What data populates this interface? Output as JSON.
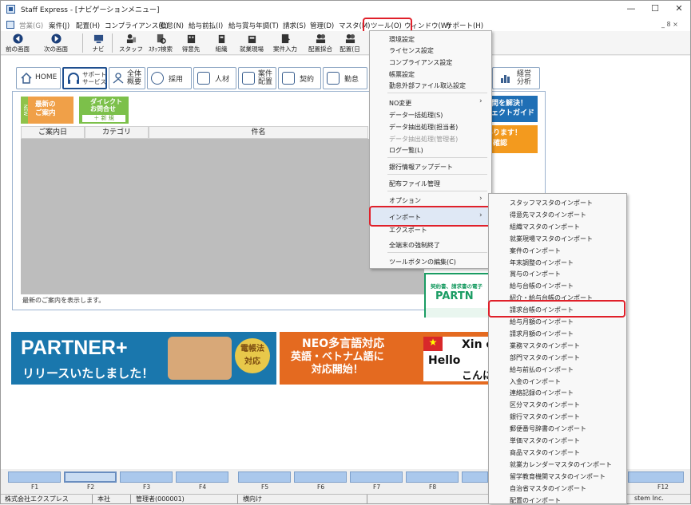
{
  "window": {
    "title": "Staff Express - [ナビゲーションメニュー]",
    "minimize": "—",
    "maximize": "☐",
    "close": "✕"
  },
  "menubar": {
    "items": [
      "営業(G)",
      "案件(J)",
      "配置(H)",
      "コンプライアンス(C)",
      "勤怠(N)",
      "給与前払(I)",
      "給与賞与年調(T)",
      "請求(S)",
      "管理(D)",
      "マスタ(M)",
      "ツール(O)",
      "ウィンドウ(W)",
      "サポート(H)"
    ],
    "mdi": "_ 8 ×"
  },
  "toolbar": {
    "items": [
      "前の画面",
      "次の画面",
      "ナビ",
      "スタッフ",
      "ｽﾀｯﾌ検索",
      "得意先",
      "組織",
      "就業現場",
      "案件入力",
      "配置採合",
      "配置(日"
    ]
  },
  "tabs": [
    "HOME",
    "サポート\nサービス",
    "全体\n概要",
    "採用",
    "人材",
    "案件\n配置",
    "契約",
    "勤怠",
    "経営\n分析"
  ],
  "notice": {
    "new_badge": "NEW",
    "btn_latest": "最新の\nご案内",
    "btn_direct": "ダイレクト\nお問合せ",
    "btn_new": "＋ 新 規",
    "columns": [
      "ご案内日",
      "カテゴリ",
      "件名"
    ],
    "footer": "最新のご案内を表示します。"
  },
  "side_banners": {
    "blue": "問を解決！\nェクトガイド",
    "orange": "ンがあります！\nートを確認",
    "teal_top": "契約書、請求書の電子",
    "teal_main": "PARTN",
    "teal_sub": "無料お"
  },
  "ads": {
    "partner_title": "PARTNER+",
    "partner_sub": "リリースいたしました！",
    "partner_badge": "電帳法\n対応",
    "neo_title": "NEO多言語対応",
    "neo_sub": "英語・ベトナム語に\n対応開始！",
    "neo_words": [
      "Xin c",
      "Hello",
      "こんに"
    ]
  },
  "tool_menu": {
    "items": [
      "環境設定",
      "ライセンス設定",
      "コンプライアンス設定",
      "帳票設定",
      "勤怠外部ファイル取込設定",
      "NO変更",
      "データ一括処理(S)",
      "データ抽出処理(担当者)",
      "データ抽出処理(管理者)",
      "ログ一覧(L)",
      "銀行情報アップデート",
      "配布ファイル管理",
      "オプション",
      "インポート",
      "エクスポート",
      "全端末の強制終了",
      "ツールボタンの編集(C)"
    ],
    "disabled": [
      "データ抽出処理(管理者)"
    ],
    "submenu_arrow": "›"
  },
  "import_submenu": {
    "items": [
      "スタッフマスタのインポート",
      "得意先マスタのインポート",
      "組織マスタのインポート",
      "就業現場マスタのインポート",
      "案件のインポート",
      "年末調整のインポート",
      "賞与のインポート",
      "給与台帳のインポート",
      "紹介・給与台帳のインポート",
      "請求台帳のインポート",
      "給与月額のインポート",
      "請求月額のインポート",
      "業務マスタのインポート",
      "部門マスタのインポート",
      "給与前払のインポート",
      "入金のインポート",
      "連絡記録のインポート",
      "区分マスタのインポート",
      "銀行マスタのインポート",
      "郵便番号辞書のインポート",
      "単価マスタのインポート",
      "商品マスタのインポート",
      "就業カレンダーマスタのインポート",
      "留学教育機関マスタのインポート",
      "自治省マスタのインポート",
      "配置のインポート"
    ]
  },
  "fkeys": [
    "F1",
    "F2",
    "F3",
    "F4",
    "F5",
    "F6",
    "F7",
    "F8",
    "F12"
  ],
  "status": [
    "株式会社エクスプレス",
    "本社",
    "管理者(000001)",
    "横向け",
    "stem Inc."
  ],
  "colors": {
    "highlight": "#e0202a",
    "accent": "#1f6fb5"
  }
}
